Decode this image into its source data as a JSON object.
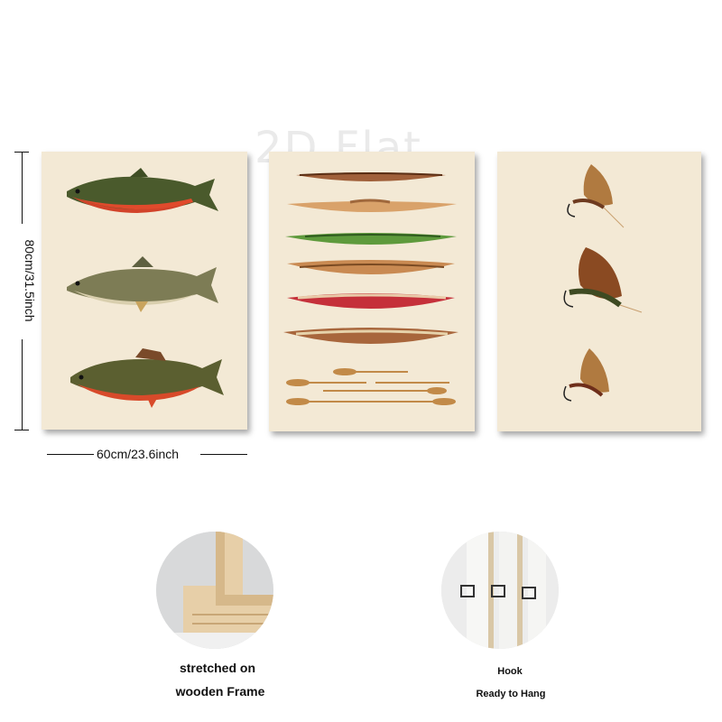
{
  "watermark": "2D Flat",
  "dimensions": {
    "height": "80cm/31.5inch",
    "width": "60cm/23.6inch"
  },
  "features": [
    {
      "name": "frame",
      "caption_lines": [
        "stretched on",
        "wooden Frame"
      ]
    },
    {
      "name": "hook",
      "caption_lines": [
        "Hook",
        "Ready to Hang"
      ]
    }
  ],
  "colors": {
    "canvas": "#f3e9d5",
    "fish_belly_red": "#d2432a",
    "canoe_green": "#5e9a3c",
    "canoe_red": "#c5303a",
    "wood": "#c98a52"
  }
}
